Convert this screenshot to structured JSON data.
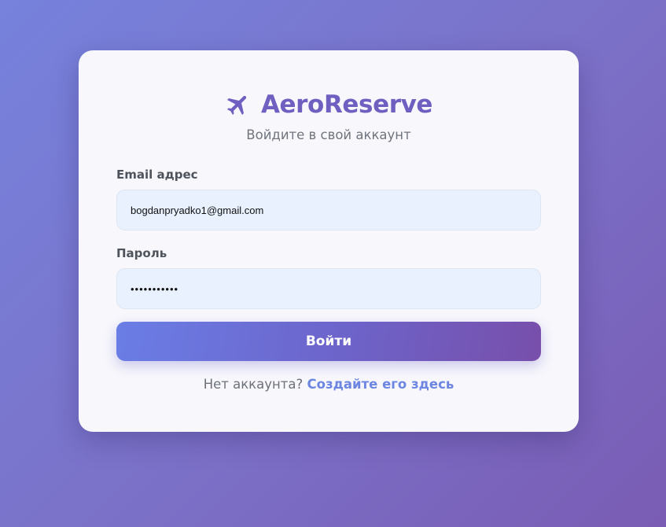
{
  "brand": {
    "title": "AeroReserve",
    "icon": "plane-icon",
    "color": "#6f5fc0"
  },
  "subtitle": "Войдите в свой аккаунт",
  "form": {
    "email_label": "Email адрес",
    "email_value": "bogdanpryadko1@gmail.com",
    "password_label": "Пароль",
    "password_value": "•••••••••••",
    "submit_label": "Войти"
  },
  "footer": {
    "prompt": "Нет аккаунта?",
    "link_label": "Создайте его здесь",
    "link_color": "#6c86e2"
  },
  "colors": {
    "background_start": "#7682dc",
    "background_end": "#7a5cb4",
    "card": "#f7f7fc",
    "input_bg": "#e8f1fd"
  }
}
